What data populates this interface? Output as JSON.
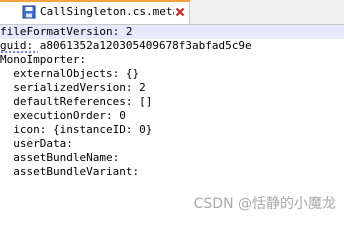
{
  "tab": {
    "title": "CallSingleton.cs.meta",
    "accent_color": "#f2a53c"
  },
  "icons": {
    "arrow": "tab-scroll-arrow-icon",
    "file": "file-save-icon",
    "close": "close-icon"
  },
  "editor": {
    "lines": [
      "fileFormatVersion: 2",
      "guid: a8061352a120305409678f3abfad5c9e",
      "MonoImporter:",
      "  externalObjects: {}",
      "  serializedVersion: 2",
      "  defaultReferences: []",
      "  executionOrder: 0",
      "  icon: {instanceID: 0}",
      "  userData:",
      "  assetBundleName:",
      "  assetBundleVariant:"
    ]
  },
  "watermark": {
    "text": "CSDN @恬静的小魔龙"
  }
}
